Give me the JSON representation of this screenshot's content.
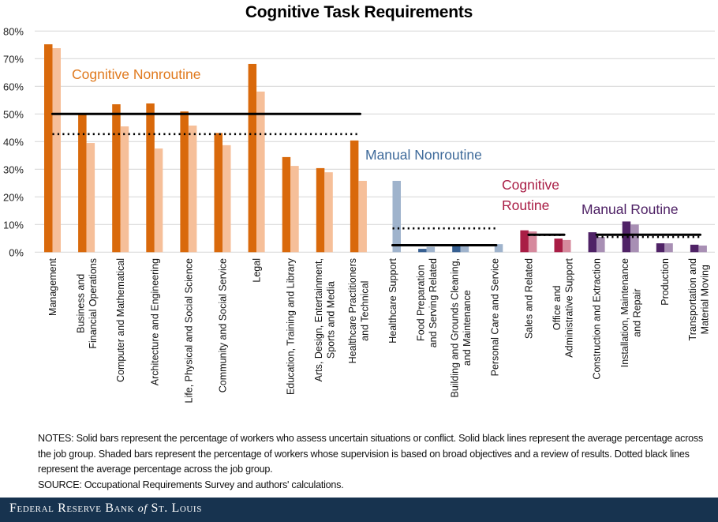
{
  "chart_data": {
    "type": "bar",
    "title": "Cognitive Task Requirements",
    "xlabel": "",
    "ylabel": "",
    "ylim": [
      0,
      80
    ],
    "yticks": [
      "0%",
      "10%",
      "20%",
      "30%",
      "40%",
      "50%",
      "60%",
      "70%",
      "80%"
    ],
    "grid": true,
    "categories": [
      "Management",
      "Business and Financial Operations",
      "Computer and Mathematical",
      "Architecture and Engineering",
      "Life, Physical and Social Science",
      "Community and Social Service",
      "Legal",
      "Education, Training and Library",
      "Arts, Design, Entertainment, Sports and Media",
      "Healthcare Practitioners and Technical",
      "Healthcare Support",
      "Food Preparation and Serving Related",
      "Building and Grounds Cleaning, and Maintenance",
      "Personal Care and Service",
      "Sales and Related",
      "Office and Administrative Support",
      "Construction and Extraction",
      "Installation, Maintenance and Repair",
      "Production",
      "Transportation and Material Moving"
    ],
    "category_label_lines": [
      [
        "Management"
      ],
      [
        "Business and",
        "Financial Operations"
      ],
      [
        "Computer and Mathematical"
      ],
      [
        "Architecture and Engineering"
      ],
      [
        "Life, Physical and Social Science"
      ],
      [
        "Community and Social Service"
      ],
      [
        "Legal"
      ],
      [
        "Education, Training and Library"
      ],
      [
        "Arts, Design, Entertainment,",
        "Sports and Media"
      ],
      [
        "Healthcare Practitioners",
        "and Technical"
      ],
      [
        "Healthcare Support"
      ],
      [
        "Food Preparation",
        "and Serving Related"
      ],
      [
        "Building and Grounds Cleaning,",
        "and Maintenance"
      ],
      [
        "Personal Care and Service"
      ],
      [
        "Sales and Related"
      ],
      [
        "Office and",
        "Administrative Support"
      ],
      [
        "Construction and Extraction"
      ],
      [
        "Installation, Maintenance",
        "and Repair"
      ],
      [
        "Production"
      ],
      [
        "Transportation and",
        "Material Moving"
      ]
    ],
    "series": [
      {
        "name": "Assess uncertain situations or conflict (solid bars)",
        "values": [
          75.2,
          49.7,
          53.5,
          53.8,
          50.9,
          43.1,
          68.1,
          34.4,
          30.4,
          40.4,
          0.0,
          1.2,
          2.9,
          0.0,
          7.9,
          4.9,
          7.2,
          11.1,
          3.2,
          2.7
        ]
      },
      {
        "name": "Supervision based on broad objectives and review of results (shaded bars)",
        "values": [
          73.8,
          39.5,
          45.5,
          37.5,
          45.8,
          38.7,
          58.1,
          31.2,
          28.9,
          25.8,
          25.8,
          1.9,
          2.9,
          2.9,
          7.5,
          4.4,
          5.5,
          10.0,
          3.2,
          2.4
        ]
      }
    ],
    "groups": [
      {
        "name": "Cognitive Nonroutine",
        "label_lines": [
          "Cognitive  Nonroutine"
        ],
        "start": 0,
        "end": 9,
        "solid_avg": 50.0,
        "dotted_avg": 42.7,
        "solid_color": "#d9690b",
        "shaded_color": "#f6bf99",
        "label_color": "#e07a1f"
      },
      {
        "name": "Manual Nonroutine",
        "label_lines": [
          "Manual Nonroutine"
        ],
        "start": 10,
        "end": 13,
        "solid_avg": 2.5,
        "dotted_avg": 8.6,
        "solid_color": "#365f91",
        "shaded_color": "#9fb3cc",
        "label_color": "#3e6a9a"
      },
      {
        "name": "Cognitive Routine",
        "label_lines": [
          "Cognitive",
          "Routine"
        ],
        "start": 14,
        "end": 15,
        "solid_avg": 6.3,
        "dotted_avg": 6.2,
        "solid_color": "#a91d45",
        "shaded_color": "#d6899d",
        "label_color": "#a91d45"
      },
      {
        "name": "Manual Routine",
        "label_lines": [
          "Manual Routine"
        ],
        "start": 16,
        "end": 19,
        "solid_avg": 6.3,
        "dotted_avg": 5.5,
        "solid_color": "#4f2266",
        "shaded_color": "#a88fb4",
        "label_color": "#4f2266"
      }
    ],
    "legend": "none"
  },
  "notes": {
    "line1": "NOTES: Solid bars represent the percentage of workers who assess uncertain situations or conflict. Solid black lines represent the average percentage across the job group. Shaded bars represent the percentage of workers whose supervision is based on broad objectives and a review of results. Dotted black lines represent the average percentage across the job group.",
    "source": "SOURCE: Occupational Requirements Survey and authors' calculations."
  },
  "footer": {
    "brand_before": "Federal Reserve Bank",
    "brand_of": "of",
    "brand_after": "St. Louis"
  }
}
